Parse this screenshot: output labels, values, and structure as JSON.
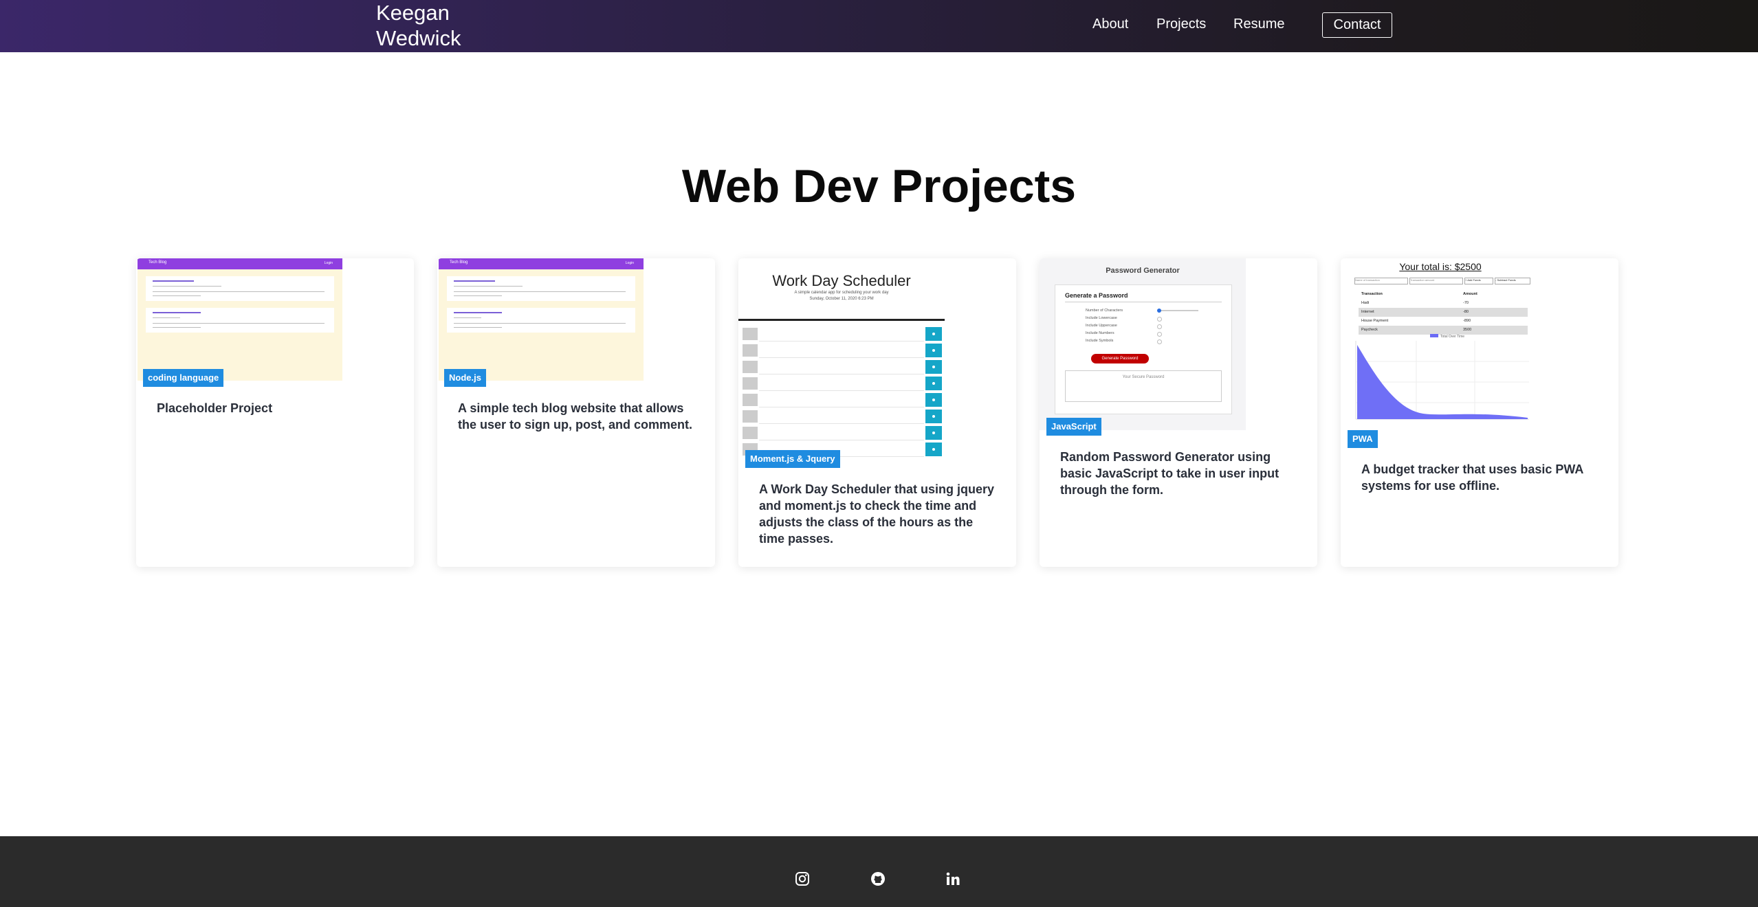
{
  "nav": {
    "brand_line1": "Keegan",
    "brand_line2": "Wedwick",
    "links": [
      "About",
      "Projects",
      "Resume"
    ],
    "contact": "Contact"
  },
  "page_title": "Web Dev Projects",
  "projects": [
    {
      "tag": "coding language",
      "description": "Placeholder Project",
      "thumbnail": "tech-blog-screenshot"
    },
    {
      "tag": "Node.js",
      "description": "A simple tech blog website that allows the user to sign up, post, and comment.",
      "thumbnail": "tech-blog-screenshot"
    },
    {
      "tag": "Moment.js & Jquery",
      "description": "A Work Day Scheduler that using jquery and moment.js to check the time and adjusts the class of the hours as the time passes.",
      "thumbnail": "work-day-scheduler-screenshot"
    },
    {
      "tag": "JavaScript",
      "description": "Random Password Generator using basic JavaScript to take in user input through the form.",
      "thumbnail": "password-generator-screenshot"
    },
    {
      "tag": "PWA",
      "description": "A budget tracker that uses basic PWA systems for use offline.",
      "thumbnail": "budget-tracker-screenshot"
    }
  ],
  "thumbnails": {
    "blog": {
      "site_title": "Tech Blog",
      "login": "Login",
      "post1_title": "Here is a sample post!",
      "post2_title": "Here is another sample post!"
    },
    "scheduler": {
      "title": "Work Day Scheduler",
      "subtitle": "A simple calendar app for scheduling your work day",
      "date": "Sunday, October 11, 2020 6:23 PM"
    },
    "password": {
      "title": "Password Generator",
      "card_title": "Generate a Password",
      "options": [
        "Number of Characters",
        "Include Lowercase",
        "Include Uppercase",
        "Include Numbers",
        "Include Symbols"
      ],
      "button": "Generate Password",
      "placeholder": "Your Secure Password"
    },
    "budget": {
      "total": "Your total is: $2500",
      "name_placeholder": "Name of transaction",
      "amount_placeholder": "Transaction amount",
      "add": "+ Add Funds",
      "subtract": "- Subtract Funds",
      "headers": [
        "Transaction",
        "Amount"
      ],
      "rows": [
        [
          "Hadi",
          "-70"
        ],
        [
          "Internet",
          "-80"
        ],
        [
          "House Payment",
          "-890"
        ],
        [
          "Paycheck",
          "3500"
        ]
      ],
      "legend": "Total Over Time"
    }
  },
  "footer": {
    "icons": [
      "instagram-icon",
      "github-icon",
      "linkedin-icon"
    ]
  },
  "colors": {
    "nav_gradient_start": "#3b2769",
    "nav_gradient_end": "#1a1816",
    "tag_blue": "#1f8ce0",
    "footer_bg": "#2b2b2b"
  }
}
